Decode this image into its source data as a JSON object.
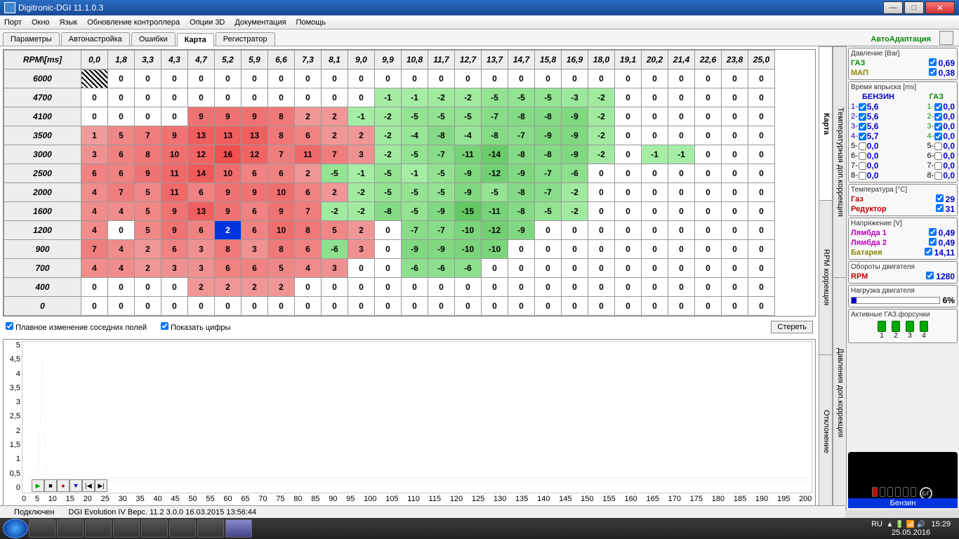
{
  "window": {
    "title": "Digitronic-DGI  11.1.0.3"
  },
  "menu": [
    "Порт",
    "Окно",
    "Язык",
    "Обновление контроллера",
    "Опции 3D",
    "Документация",
    "Помощь"
  ],
  "tabs": [
    "Параметры",
    "Автонастройка",
    "Ошибки",
    "Карта",
    "Регистратор"
  ],
  "active_tab": 3,
  "adapt_label": "АвтоАдаптация",
  "side_tabs_1": [
    "Карта",
    "RPM коррекция",
    "Отклонение"
  ],
  "side_tabs_2": [
    "Температурная доп.коррекция",
    "Давления доп.коррекция"
  ],
  "grid": {
    "corner": "RPM\\[ms]",
    "cols": [
      "0,0",
      "1,8",
      "3,3",
      "4,3",
      "4,7",
      "5,2",
      "5,9",
      "6,6",
      "7,3",
      "8,1",
      "9,0",
      "9,9",
      "10,8",
      "11,7",
      "12,7",
      "13,7",
      "14,7",
      "15,8",
      "16,9",
      "18,0",
      "19,1",
      "20,2",
      "21,4",
      "22,6",
      "23,8",
      "25,0"
    ],
    "rows": [
      "6000",
      "4700",
      "4100",
      "3500",
      "3000",
      "2500",
      "2000",
      "1600",
      "1200",
      "900",
      "700",
      "400",
      "0"
    ],
    "cells": [
      [
        null,
        0,
        0,
        0,
        0,
        0,
        0,
        0,
        0,
        0,
        0,
        0,
        0,
        0,
        0,
        0,
        0,
        0,
        0,
        0,
        0,
        0,
        0,
        0,
        0,
        0
      ],
      [
        0,
        0,
        0,
        0,
        0,
        0,
        0,
        0,
        0,
        0,
        0,
        -1,
        -1,
        -2,
        -2,
        -5,
        -5,
        -5,
        -3,
        -2,
        0,
        0,
        0,
        0,
        0,
        0
      ],
      [
        0,
        0,
        0,
        0,
        9,
        9,
        9,
        8,
        2,
        2,
        -1,
        -2,
        -5,
        -5,
        -5,
        -7,
        -8,
        -8,
        -9,
        -2,
        0,
        0,
        0,
        0,
        0,
        0
      ],
      [
        1,
        5,
        7,
        9,
        13,
        13,
        13,
        8,
        6,
        2,
        2,
        -2,
        -4,
        -8,
        -4,
        -8,
        -7,
        -9,
        -9,
        -2,
        0,
        0,
        0,
        0,
        0,
        0
      ],
      [
        3,
        6,
        8,
        10,
        12,
        16,
        12,
        7,
        11,
        7,
        3,
        -2,
        -5,
        -7,
        -11,
        -14,
        -8,
        -8,
        -9,
        -2,
        0,
        -1,
        -1,
        0,
        0,
        0
      ],
      [
        6,
        6,
        9,
        11,
        14,
        10,
        6,
        6,
        2,
        -5,
        -1,
        -5,
        -1,
        -5,
        -9,
        -12,
        -9,
        -7,
        -6,
        0,
        0,
        0,
        0,
        0,
        0,
        0
      ],
      [
        4,
        7,
        5,
        11,
        6,
        9,
        9,
        10,
        6,
        2,
        -2,
        -5,
        -5,
        -5,
        -9,
        -5,
        -8,
        -7,
        -2,
        0,
        0,
        0,
        0,
        0,
        0,
        0
      ],
      [
        4,
        4,
        5,
        9,
        13,
        9,
        6,
        9,
        7,
        -2,
        -2,
        -8,
        -5,
        -9,
        -15,
        -11,
        -8,
        -5,
        -2,
        0,
        0,
        0,
        0,
        0,
        0,
        0
      ],
      [
        4,
        0,
        5,
        9,
        6,
        2,
        6,
        10,
        8,
        5,
        2,
        0,
        -7,
        -7,
        -10,
        -12,
        -9,
        0,
        0,
        0,
        0,
        0,
        0,
        0,
        0,
        0
      ],
      [
        7,
        4,
        2,
        6,
        3,
        8,
        3,
        8,
        6,
        -6,
        3,
        0,
        -9,
        -9,
        -10,
        -10,
        0,
        0,
        0,
        0,
        0,
        0,
        0,
        0,
        0,
        0
      ],
      [
        4,
        4,
        2,
        3,
        3,
        6,
        6,
        5,
        4,
        3,
        0,
        0,
        -6,
        -6,
        -6,
        0,
        0,
        0,
        0,
        0,
        0,
        0,
        0,
        0,
        0,
        0
      ],
      [
        0,
        0,
        0,
        0,
        2,
        2,
        2,
        2,
        0,
        0,
        0,
        0,
        0,
        0,
        0,
        0,
        0,
        0,
        0,
        0,
        0,
        0,
        0,
        0,
        0,
        0
      ],
      [
        0,
        0,
        0,
        0,
        0,
        0,
        0,
        0,
        0,
        0,
        0,
        0,
        0,
        0,
        0,
        0,
        0,
        0,
        0,
        0,
        0,
        0,
        0,
        0,
        0,
        0
      ]
    ],
    "selected": [
      8,
      5
    ]
  },
  "checks": {
    "smooth": "Плавное изменение соседних полей",
    "shownum": "Показать цифры",
    "erase": "Стереть"
  },
  "chart_data": {
    "type": "line",
    "x_range": [
      0,
      200
    ],
    "y_range": [
      0,
      5
    ],
    "y_ticks": [
      "5",
      "4,5",
      "4",
      "3,5",
      "3",
      "2,5",
      "2",
      "1,5",
      "1",
      "0,5",
      "0"
    ],
    "x_ticks": [
      0,
      5,
      10,
      15,
      20,
      25,
      30,
      35,
      40,
      45,
      50,
      55,
      60,
      65,
      70,
      75,
      80,
      85,
      90,
      95,
      100,
      105,
      110,
      115,
      120,
      125,
      130,
      135,
      140,
      145,
      150,
      155,
      160,
      165,
      170,
      175,
      180,
      185,
      190,
      195,
      200
    ],
    "series": [
      {
        "name": "blue",
        "color": "#0033dd",
        "points": [
          [
            2,
            0.1
          ],
          [
            4,
            0.2
          ],
          [
            5,
            4.5
          ],
          [
            6,
            0.6
          ],
          [
            8,
            0.5
          ],
          [
            15,
            0.45
          ],
          [
            30,
            0.5
          ],
          [
            60,
            0.5
          ],
          [
            100,
            0.5
          ],
          [
            150,
            0.48
          ],
          [
            200,
            0.5
          ]
        ]
      },
      {
        "name": "orange",
        "color": "#cc6600",
        "points": [
          [
            0,
            1.5
          ],
          [
            200,
            1.5
          ]
        ]
      },
      {
        "name": "magenta",
        "color": "#c000c0",
        "points": [
          [
            0,
            0.49
          ],
          [
            200,
            0.49
          ]
        ]
      },
      {
        "name": "green",
        "color": "#0a8a0a",
        "points": [
          [
            5,
            0.4
          ],
          [
            200,
            0.4
          ]
        ]
      }
    ]
  },
  "rpanel": {
    "pressure": {
      "title": "Давление [Bar]",
      "gas_label": "ГАЗ",
      "gas_val": "0,69",
      "map_label": "МАП",
      "map_val": "0,38"
    },
    "injtime": {
      "title": "Время впрыска [ms]",
      "petrol_label": "БЕНЗИН",
      "gas_label": "ГАЗ",
      "rows": [
        [
          "1-",
          "5,6",
          "1-",
          "0,0"
        ],
        [
          "2-",
          "5,6",
          "2-",
          "0,0"
        ],
        [
          "3-",
          "5,6",
          "3-",
          "0,0"
        ],
        [
          "4-",
          "5,7",
          "4-",
          "0,0"
        ],
        [
          "5-",
          "0,0",
          "5-",
          "0,0"
        ],
        [
          "6-",
          "0,0",
          "6-",
          "0,0"
        ],
        [
          "7-",
          "0,0",
          "7-",
          "0,0"
        ],
        [
          "8-",
          "0,0",
          "8-",
          "0,0"
        ]
      ]
    },
    "temp": {
      "title": "Температура [°C]",
      "gas": "Газ",
      "gas_val": "29",
      "red": "Редуктор",
      "red_val": "31"
    },
    "volt": {
      "title": "Напряжение [V]",
      "l1": "Лямбда 1",
      "l1v": "0,49",
      "l2": "Лямбда 2",
      "l2v": "0,49",
      "bat": "Батарея",
      "batv": "14,11"
    },
    "rpm": {
      "title": "Обороты двигателя",
      "lbl": "RPM",
      "val": "1280"
    },
    "load": {
      "title": "Нагрузка двигателя",
      "val": "6%"
    },
    "injectors": {
      "title": "Активные ГАЗ.форсунки",
      "nums": [
        "1",
        "2",
        "3",
        "4"
      ]
    },
    "fuel_label": "Бензин"
  },
  "status": {
    "conn": "Подключен",
    "info": "DGI Evolution IV   Верс. 11.2  3.0.0   16.03.2015 13:56:44"
  },
  "tray": {
    "lang": "RU",
    "time": "15:29",
    "date": "25.05.2016"
  }
}
